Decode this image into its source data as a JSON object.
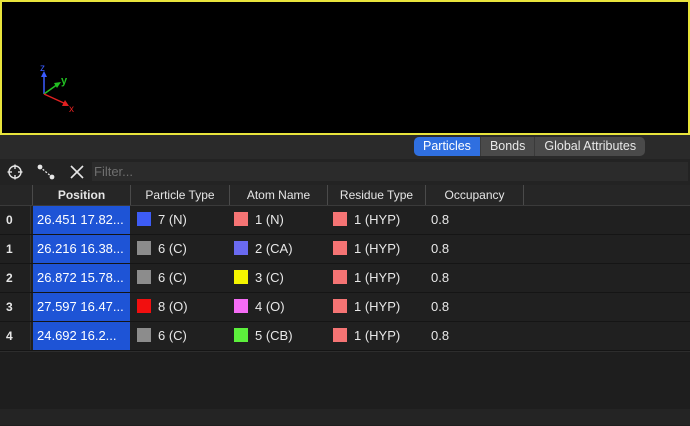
{
  "viewport": {
    "axes": {
      "z": "z",
      "y": "y",
      "x": "x"
    }
  },
  "tabs": [
    {
      "label": "Particles",
      "active": true
    },
    {
      "label": "Bonds",
      "active": false
    },
    {
      "label": "Global Attributes",
      "active": false
    }
  ],
  "toolbar": {
    "icons": [
      "crosshair-icon",
      "bond-pick-icon",
      "close-icon"
    ],
    "filter_placeholder": "Filter..."
  },
  "table": {
    "columns": [
      "Position",
      "Particle Type",
      "Atom Name",
      "Residue Type",
      "Occupancy"
    ],
    "rows": [
      {
        "index": "0",
        "position": "26.451 17.82...",
        "particle_type": {
          "label": "7 (N)",
          "color": "#3d5cf5"
        },
        "atom_name": {
          "label": "1 (N)",
          "color": "#f57474"
        },
        "residue_type": {
          "label": "1 (HYP)",
          "color": "#f57474"
        },
        "occupancy": "0.8"
      },
      {
        "index": "1",
        "position": "26.216 16.38...",
        "particle_type": {
          "label": "6 (C)",
          "color": "#8c8c8c"
        },
        "atom_name": {
          "label": "2 (CA)",
          "color": "#6a6af0"
        },
        "residue_type": {
          "label": "1 (HYP)",
          "color": "#f57474"
        },
        "occupancy": "0.8"
      },
      {
        "index": "2",
        "position": "26.872 15.78...",
        "particle_type": {
          "label": "6 (C)",
          "color": "#8c8c8c"
        },
        "atom_name": {
          "label": "3 (C)",
          "color": "#f5f500"
        },
        "residue_type": {
          "label": "1 (HYP)",
          "color": "#f57474"
        },
        "occupancy": "0.8"
      },
      {
        "index": "3",
        "position": "27.597 16.47...",
        "particle_type": {
          "label": "8 (O)",
          "color": "#f20f0f"
        },
        "atom_name": {
          "label": "4 (O)",
          "color": "#f56cf5"
        },
        "residue_type": {
          "label": "1 (HYP)",
          "color": "#f57474"
        },
        "occupancy": "0.8"
      },
      {
        "index": "4",
        "position": "24.692 16.2...",
        "particle_type": {
          "label": "6 (C)",
          "color": "#8c8c8c"
        },
        "atom_name": {
          "label": "5 (CB)",
          "color": "#5cf03c"
        },
        "residue_type": {
          "label": "1 (HYP)",
          "color": "#f57474"
        },
        "occupancy": "0.8"
      }
    ]
  },
  "colors": {
    "viewport_border": "#e8e43c",
    "selection": "#1e54d6",
    "tab_active": "#2f6fe0",
    "axis_x": "#e02020",
    "axis_y": "#22c022",
    "axis_z": "#3a5bff"
  }
}
